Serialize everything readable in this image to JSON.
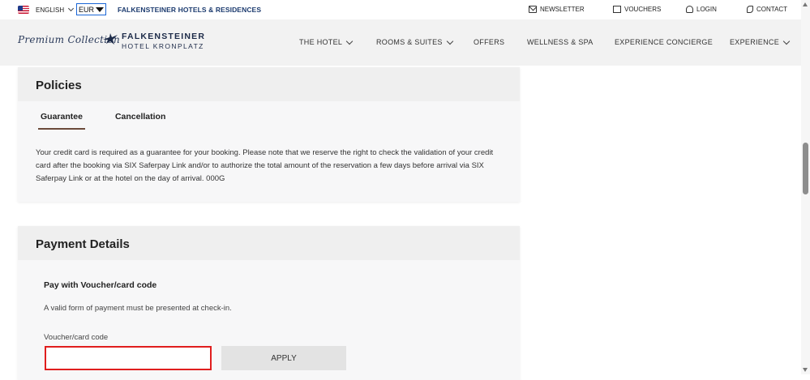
{
  "topbar": {
    "language": "ENGLISH",
    "currency": "EUR",
    "brand_link": "FALKENSTEINER HOTELS & RESIDENCES",
    "newsletter": "NEWSLETTER",
    "vouchers": "VOUCHERS",
    "login": "LOGIN",
    "contact": "CONTACT"
  },
  "logo": {
    "script": "Premium Collection",
    "name": "FALKENSTEINER",
    "sub": "HOTEL KRONPLATZ"
  },
  "nav": {
    "items": [
      {
        "label": "THE HOTEL",
        "has_dropdown": true
      },
      {
        "label": "ROOMS & SUITES",
        "has_dropdown": true
      },
      {
        "label": "OFFERS",
        "has_dropdown": false
      },
      {
        "label": "WELLNESS & SPA",
        "has_dropdown": false
      },
      {
        "label": "EXPERIENCE CONCIERGE",
        "has_dropdown": false
      },
      {
        "label": "EXPERIENCE",
        "has_dropdown": true
      }
    ]
  },
  "policies": {
    "title": "Policies",
    "tabs": [
      {
        "label": "Guarantee",
        "active": true
      },
      {
        "label": "Cancellation",
        "active": false
      }
    ],
    "text": "Your credit card is required as a guarantee for your booking. Please note that we reserve the right to check the validation of your credit card after the booking via SIX Saferpay Link and/or to authorize the total amount of the reservation a few days before arrival via SIX Saferpay Link or at the hotel on the day of arrival. 000G"
  },
  "payment": {
    "title": "Payment Details",
    "subtitle": "Pay with Voucher/card code",
    "note": "A valid form of payment must be presented at check-in.",
    "voucher_label": "Voucher/card code",
    "voucher_value": "",
    "apply_label": "APPLY"
  },
  "colors": {
    "brand_navy": "#1c3b6f",
    "tab_underline": "#6b4a3a",
    "input_error_border": "#e01e1e",
    "currency_focus": "#1a66d6"
  }
}
